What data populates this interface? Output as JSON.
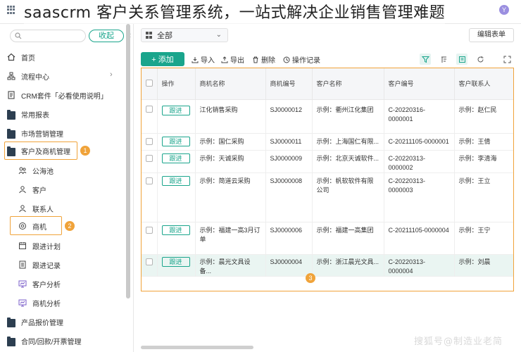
{
  "overlay_title": "saascrm 客户关系管理系统，一站式解决企业销售管理难题",
  "top": {
    "avatar": "Y"
  },
  "sidebar": {
    "collapse_label": "收起",
    "items": [
      {
        "label": "首页",
        "icon": "home-icon"
      },
      {
        "label": "流程中心",
        "icon": "flow-icon"
      },
      {
        "label": "CRM套件「必看使用说明」",
        "icon": "doc-icon"
      },
      {
        "label": "常用报表",
        "icon": "folder-icon"
      },
      {
        "label": "市场营销管理",
        "icon": "folder-icon"
      },
      {
        "label": "客户及商机管理",
        "icon": "folder-icon"
      },
      {
        "label": "公海池",
        "icon": "people-icon"
      },
      {
        "label": "客户",
        "icon": "person-icon"
      },
      {
        "label": "联系人",
        "icon": "person-icon"
      },
      {
        "label": "商机",
        "icon": "target-icon"
      },
      {
        "label": "跟进计划",
        "icon": "calendar-icon"
      },
      {
        "label": "跟进记录",
        "icon": "list-icon"
      },
      {
        "label": "客户分析",
        "icon": "monitor-icon"
      },
      {
        "label": "商机分析",
        "icon": "monitor-icon"
      },
      {
        "label": "产品报价管理",
        "icon": "folder-icon"
      },
      {
        "label": "合同/回款/开票管理",
        "icon": "folder-icon"
      }
    ],
    "markers": [
      "1",
      "2"
    ]
  },
  "main": {
    "view_label": "全部",
    "edit_form_label": "编辑表单",
    "toolbar": {
      "add": "+ 添加",
      "import": "导入",
      "export": "导出",
      "delete": "删除",
      "history": "操作记录"
    },
    "table": {
      "columns": [
        "操作",
        "商机名称",
        "商机编号",
        "客户名称",
        "客户编号",
        "客户联系人"
      ],
      "action_label": "跟进",
      "rows": [
        [
          "江化销售采购",
          "SJ0000012",
          "示例：衢州江化集团",
          "C-20220316-0000001",
          "示例：赵仁民"
        ],
        [
          "示例：国仁采购",
          "SJ0000011",
          "示例：上海国仁有限...",
          "C-20211105-0000001",
          "示例：王倩"
        ],
        [
          "示例：天诚采购",
          "SJ0000009",
          "示例：北京天诚软件...",
          "C-20220313-0000002",
          "示例：李清海"
        ],
        [
          "示例：简道云采购",
          "SJ0000008",
          "示例：帆软软件有限公司",
          "C-20220313-0000003",
          "示例：王立"
        ],
        [
          "示例：福建一高3月订单",
          "SJ0000006",
          "示例：福建一高集团",
          "C-20211105-0000004",
          "示例：王宁"
        ],
        [
          "示例：晨光文具设备...",
          "SJ0000004",
          "示例：浙江晨光文具...",
          "C-20220313-0000004",
          "示例：刘晨"
        ]
      ]
    },
    "marker": "3"
  },
  "watermark": "搜狐号@制造业老简",
  "colors": {
    "accent": "#1aa58c",
    "highlight": "#f0a33a"
  }
}
